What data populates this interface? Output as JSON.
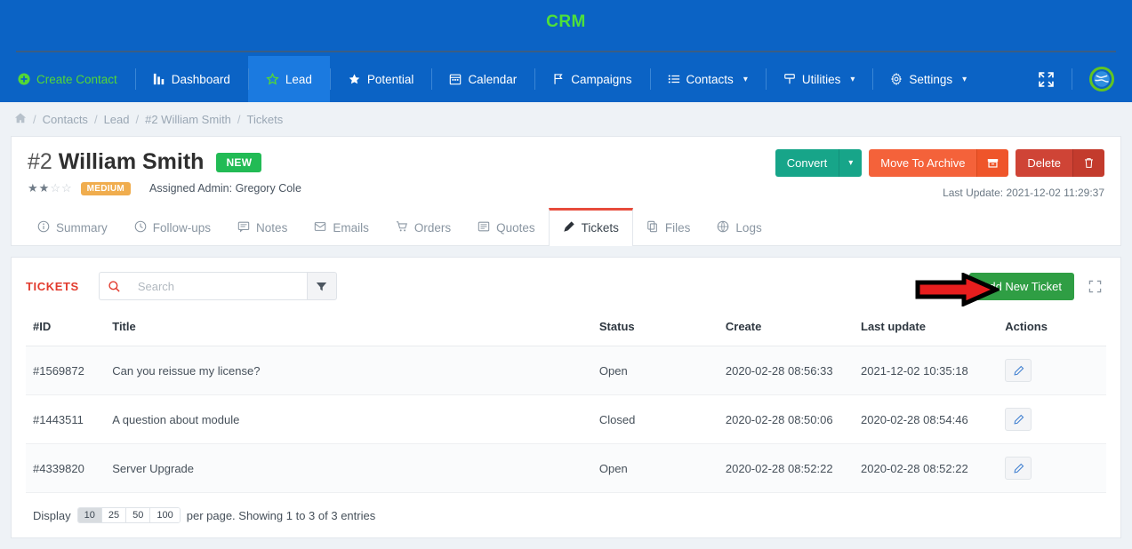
{
  "header": {
    "brand": "CRM",
    "nav": [
      {
        "label": "Create Contact",
        "icon": "plus-circle-icon",
        "style": "green",
        "caret": false
      },
      {
        "label": "Dashboard",
        "icon": "bar-chart-icon",
        "style": "plain",
        "caret": false
      },
      {
        "label": "Lead",
        "icon": "star-outline-icon",
        "style": "active",
        "caret": false
      },
      {
        "label": "Potential",
        "icon": "star-filled-icon",
        "style": "plain",
        "caret": false
      },
      {
        "label": "Calendar",
        "icon": "calendar-icon",
        "style": "plain",
        "caret": false
      },
      {
        "label": "Campaigns",
        "icon": "flag-icon",
        "style": "plain",
        "caret": false
      },
      {
        "label": "Contacts",
        "icon": "list-icon",
        "style": "plain",
        "caret": true
      },
      {
        "label": "Utilities",
        "icon": "signpost-icon",
        "style": "plain",
        "caret": true
      },
      {
        "label": "Settings",
        "icon": "gear-icon",
        "style": "plain",
        "caret": true
      }
    ],
    "fullscreen_icon": "expand-arrows-icon",
    "avatar_icon": "globe-avatar-icon"
  },
  "breadcrumb": {
    "home_icon": "home-icon",
    "items": [
      "Contacts",
      "Lead",
      "#2 William Smith",
      "Tickets"
    ],
    "separator": "/"
  },
  "record": {
    "id_prefix": "#2",
    "name": "William Smith",
    "status_badge": "NEW",
    "rating": {
      "filled": 2,
      "total": 4
    },
    "priority_badge": "MEDIUM",
    "assigned": "Assigned Admin: Gregory Cole",
    "last_update": "Last Update: 2021-12-02 11:29:37",
    "buttons": {
      "convert": "Convert",
      "convert_caret_icon": "chevron-down-icon",
      "archive": "Move To Archive",
      "archive_icon": "archive-box-icon",
      "delete": "Delete",
      "delete_icon": "trash-icon"
    }
  },
  "tabs": [
    {
      "label": "Summary",
      "icon": "info-circle-icon",
      "active": false
    },
    {
      "label": "Follow-ups",
      "icon": "clock-icon",
      "active": false
    },
    {
      "label": "Notes",
      "icon": "note-icon",
      "active": false
    },
    {
      "label": "Emails",
      "icon": "envelope-icon",
      "active": false
    },
    {
      "label": "Orders",
      "icon": "cart-icon",
      "active": false
    },
    {
      "label": "Quotes",
      "icon": "document-icon",
      "active": false
    },
    {
      "label": "Tickets",
      "icon": "ticket-icon",
      "active": true
    },
    {
      "label": "Files",
      "icon": "files-icon",
      "active": false
    },
    {
      "label": "Logs",
      "icon": "globe-grid-icon",
      "active": false
    }
  ],
  "tickets_panel": {
    "label": "TICKETS",
    "search": {
      "value": "",
      "placeholder": "Search",
      "icon": "search-icon"
    },
    "filter_icon": "funnel-icon",
    "add_button": "Add New Ticket",
    "expand_icon": "expand-arrows-icon",
    "annotation": "red-arrow-pointing-to-add-new-ticket",
    "columns": [
      "#ID",
      "Title",
      "Status",
      "Create",
      "Last update",
      "Actions"
    ],
    "rows": [
      {
        "id": "#1569872",
        "title": "Can you reissue my license?",
        "status": "Open",
        "create": "2020-02-28 08:56:33",
        "last_update": "2021-12-02 10:35:18",
        "action_icon": "edit-pencil-icon"
      },
      {
        "id": "#1443511",
        "title": "A question about module",
        "status": "Closed",
        "create": "2020-02-28 08:50:06",
        "last_update": "2020-02-28 08:54:46",
        "action_icon": "edit-pencil-icon"
      },
      {
        "id": "#4339820",
        "title": "Server Upgrade",
        "status": "Open",
        "create": "2020-02-28 08:52:22",
        "last_update": "2020-02-28 08:52:22",
        "action_icon": "edit-pencil-icon"
      }
    ],
    "footer": {
      "display_label": "Display",
      "page_sizes": [
        "10",
        "25",
        "50",
        "100"
      ],
      "active_page_size": "10",
      "summary": "per page. Showing 1 to 3 of 3 entries"
    }
  },
  "colors": {
    "header_blue": "#0b63c5",
    "brand_green": "#4ee03a",
    "accent_red": "#e23b2e",
    "success_green": "#2f9e44",
    "warning_orange": "#f0ad4e",
    "teal": "#17a589",
    "archive_orange": "#f4623a",
    "delete_red": "#cf4436"
  }
}
